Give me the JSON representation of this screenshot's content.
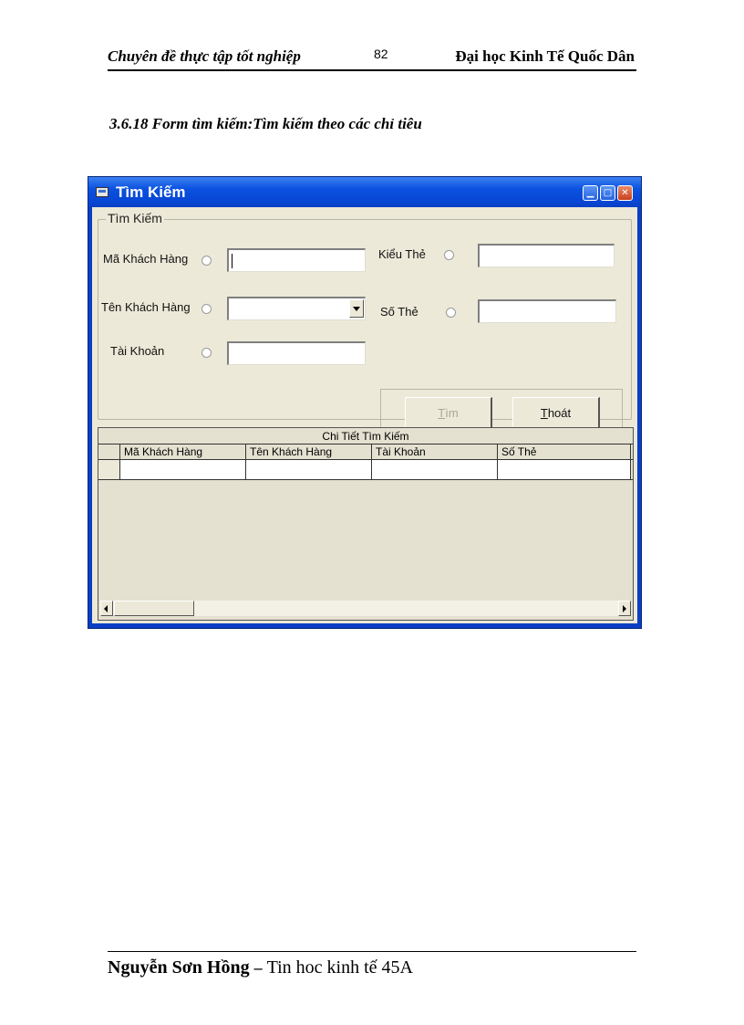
{
  "header": {
    "left": "Chuyên đề thực tập tốt nghiệp",
    "page": "82",
    "right": "Đại học Kinh  Tế Quốc Dân"
  },
  "section_title": "3.6.18 Form tìm kiếm:Tìm kiếm theo các chỉ tiêu",
  "window": {
    "title": "Tìm Kiếm",
    "icons": [
      "app-icon",
      "minimize-icon",
      "maximize-icon",
      "close-icon"
    ],
    "group_label": "Tìm Kiếm",
    "fields": {
      "ma_khach_hang": {
        "label": "Mã Khách Hàng",
        "value": ""
      },
      "ten_khach_hang": {
        "label": "Tên Khách Hàng",
        "value": ""
      },
      "tai_khoan": {
        "label": "Tài Khoản",
        "value": ""
      },
      "kieu_the": {
        "label": "Kiểu Thẻ",
        "value": ""
      },
      "so_the": {
        "label": "Số Thẻ",
        "value": ""
      }
    },
    "buttons": {
      "find": {
        "accel": "T",
        "rest": "ìm",
        "enabled": false
      },
      "exit": {
        "accel": "T",
        "rest": "hoát",
        "enabled": true
      }
    },
    "grid": {
      "caption": "Chi Tiết Tìm Kiếm",
      "columns": [
        "Mã Khách Hàng",
        "Tên Khách Hàng",
        "Tài Khoản",
        "Số Thẻ"
      ]
    }
  },
  "footer": {
    "author": "Nguyễn Sơn Hồng",
    "separator": "–",
    "class": "Tin hoc kinh tế 45A"
  },
  "colors": {
    "titlebar": "#0a51e0",
    "window_face": "#ece9d8",
    "disabled_text": "#a9a796"
  }
}
